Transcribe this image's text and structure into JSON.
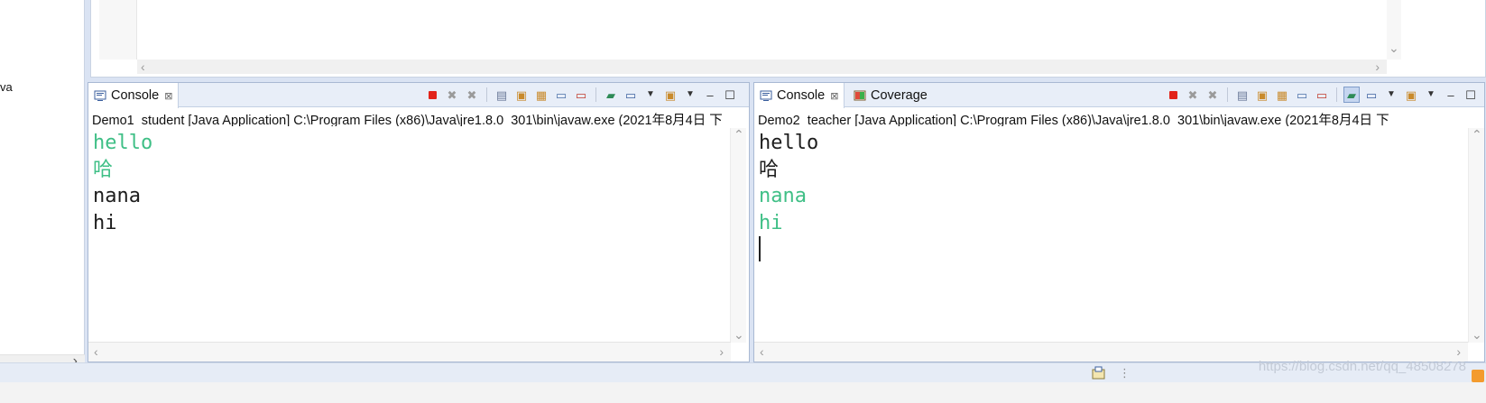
{
  "left_panel": {
    "partial_text": "va"
  },
  "consoles": [
    {
      "tabs": [
        {
          "label": "Console",
          "close": "⊠",
          "active": true
        }
      ],
      "launch_path": "Demo1_student [Java Application] C:\\Program Files (x86)\\Java\\jre1.8.0_301\\bin\\javaw.exe (2021年8月4日 下",
      "output": [
        {
          "text": "hello",
          "style": "green"
        },
        {
          "text": "哈",
          "style": "green"
        },
        {
          "text": "nana",
          "style": "dark"
        },
        {
          "text": "hi",
          "style": "dark"
        }
      ]
    },
    {
      "tabs": [
        {
          "label": "Console",
          "close": "⊠",
          "active": true
        },
        {
          "label": "Coverage",
          "active": false
        }
      ],
      "launch_path": "Demo2_teacher [Java Application] C:\\Program Files (x86)\\Java\\jre1.8.0_301\\bin\\javaw.exe (2021年8月4日 下",
      "output": [
        {
          "text": "hello",
          "style": "dark"
        },
        {
          "text": "哈",
          "style": "dark"
        },
        {
          "text": "nana",
          "style": "green"
        },
        {
          "text": "hi",
          "style": "green"
        }
      ]
    }
  ],
  "toolbar_icons": [
    "terminate-icon",
    "remove-launch-icon",
    "remove-all-icon",
    "clear-console-icon",
    "scroll-lock-icon",
    "word-wrap-icon",
    "show-on-stdout-icon",
    "show-on-stderr-icon",
    "pin-console-icon",
    "display-console-icon",
    "open-console-icon",
    "minimize-icon",
    "maximize-icon"
  ],
  "colors": {
    "output_green": "#3fbf86",
    "output_dark": "#1d1d1d",
    "terminate_red": "#e2231a"
  },
  "watermark": "https://blog.csdn.net/qq_48508278"
}
